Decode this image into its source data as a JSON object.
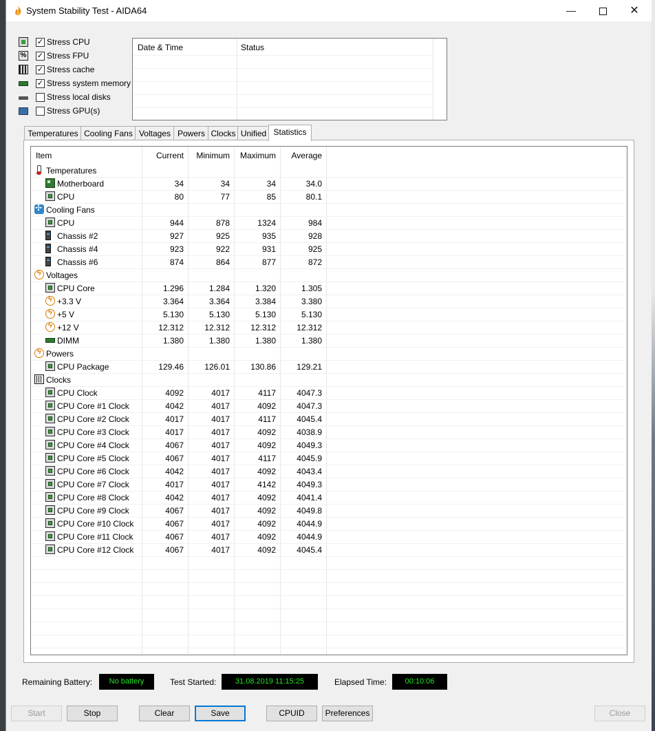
{
  "window": {
    "title": "System Stability Test - AIDA64"
  },
  "stress_options": [
    {
      "label": "Stress CPU",
      "checked": true,
      "icon": "cpu-icon"
    },
    {
      "label": "Stress FPU",
      "checked": true,
      "icon": "fpu-icon"
    },
    {
      "label": "Stress cache",
      "checked": true,
      "icon": "cache-icon"
    },
    {
      "label": "Stress system memory",
      "checked": true,
      "icon": "memory-icon"
    },
    {
      "label": "Stress local disks",
      "checked": false,
      "icon": "disk-icon"
    },
    {
      "label": "Stress GPU(s)",
      "checked": false,
      "icon": "gpu-icon"
    }
  ],
  "log": {
    "col_datetime": "Date & Time",
    "col_status": "Status"
  },
  "tabs": [
    "Temperatures",
    "Cooling Fans",
    "Voltages",
    "Powers",
    "Clocks",
    "Unified",
    "Statistics"
  ],
  "active_tab": "Statistics",
  "stats": {
    "headers": {
      "item": "Item",
      "current": "Current",
      "minimum": "Minimum",
      "maximum": "Maximum",
      "average": "Average"
    },
    "rows": [
      {
        "type": "group",
        "name": "Temperatures",
        "icon": "thermometer-icon"
      },
      {
        "type": "item",
        "name": "Motherboard",
        "icon": "motherboard-icon",
        "current": "34",
        "minimum": "34",
        "maximum": "34",
        "average": "34.0"
      },
      {
        "type": "item",
        "name": "CPU",
        "icon": "cpu-icon",
        "current": "80",
        "minimum": "77",
        "maximum": "85",
        "average": "80.1"
      },
      {
        "type": "group",
        "name": "Cooling Fans",
        "icon": "fan-icon"
      },
      {
        "type": "item",
        "name": "CPU",
        "icon": "cpu-icon",
        "current": "944",
        "minimum": "878",
        "maximum": "1324",
        "average": "984"
      },
      {
        "type": "item",
        "name": "Chassis #2",
        "icon": "chassis-icon",
        "current": "927",
        "minimum": "925",
        "maximum": "935",
        "average": "928"
      },
      {
        "type": "item",
        "name": "Chassis #4",
        "icon": "chassis-icon",
        "current": "923",
        "minimum": "922",
        "maximum": "931",
        "average": "925"
      },
      {
        "type": "item",
        "name": "Chassis #6",
        "icon": "chassis-icon",
        "current": "874",
        "minimum": "864",
        "maximum": "877",
        "average": "872"
      },
      {
        "type": "group",
        "name": "Voltages",
        "icon": "voltage-icon"
      },
      {
        "type": "item",
        "name": "CPU Core",
        "icon": "cpu-icon",
        "current": "1.296",
        "minimum": "1.284",
        "maximum": "1.320",
        "average": "1.305"
      },
      {
        "type": "item",
        "name": "+3.3 V",
        "icon": "voltage-icon",
        "current": "3.364",
        "minimum": "3.364",
        "maximum": "3.384",
        "average": "3.380"
      },
      {
        "type": "item",
        "name": "+5 V",
        "icon": "voltage-icon",
        "current": "5.130",
        "minimum": "5.130",
        "maximum": "5.130",
        "average": "5.130"
      },
      {
        "type": "item",
        "name": "+12 V",
        "icon": "voltage-icon",
        "current": "12.312",
        "minimum": "12.312",
        "maximum": "12.312",
        "average": "12.312"
      },
      {
        "type": "item",
        "name": "DIMM",
        "icon": "memory-icon",
        "current": "1.380",
        "minimum": "1.380",
        "maximum": "1.380",
        "average": "1.380"
      },
      {
        "type": "group",
        "name": "Powers",
        "icon": "voltage-icon"
      },
      {
        "type": "item",
        "name": "CPU Package",
        "icon": "cpu-icon",
        "current": "129.46",
        "minimum": "126.01",
        "maximum": "130.86",
        "average": "129.21"
      },
      {
        "type": "group",
        "name": "Clocks",
        "icon": "clock-icon"
      },
      {
        "type": "item",
        "name": "CPU Clock",
        "icon": "cpu-icon",
        "current": "4092",
        "minimum": "4017",
        "maximum": "4117",
        "average": "4047.3"
      },
      {
        "type": "item",
        "name": "CPU Core #1 Clock",
        "icon": "cpu-icon",
        "current": "4042",
        "minimum": "4017",
        "maximum": "4092",
        "average": "4047.3"
      },
      {
        "type": "item",
        "name": "CPU Core #2 Clock",
        "icon": "cpu-icon",
        "current": "4017",
        "minimum": "4017",
        "maximum": "4117",
        "average": "4045.4"
      },
      {
        "type": "item",
        "name": "CPU Core #3 Clock",
        "icon": "cpu-icon",
        "current": "4017",
        "minimum": "4017",
        "maximum": "4092",
        "average": "4038.9"
      },
      {
        "type": "item",
        "name": "CPU Core #4 Clock",
        "icon": "cpu-icon",
        "current": "4067",
        "minimum": "4017",
        "maximum": "4092",
        "average": "4049.3"
      },
      {
        "type": "item",
        "name": "CPU Core #5 Clock",
        "icon": "cpu-icon",
        "current": "4067",
        "minimum": "4017",
        "maximum": "4117",
        "average": "4045.9"
      },
      {
        "type": "item",
        "name": "CPU Core #6 Clock",
        "icon": "cpu-icon",
        "current": "4042",
        "minimum": "4017",
        "maximum": "4092",
        "average": "4043.4"
      },
      {
        "type": "item",
        "name": "CPU Core #7 Clock",
        "icon": "cpu-icon",
        "current": "4017",
        "minimum": "4017",
        "maximum": "4142",
        "average": "4049.3"
      },
      {
        "type": "item",
        "name": "CPU Core #8 Clock",
        "icon": "cpu-icon",
        "current": "4042",
        "minimum": "4017",
        "maximum": "4092",
        "average": "4041.4"
      },
      {
        "type": "item",
        "name": "CPU Core #9 Clock",
        "icon": "cpu-icon",
        "current": "4067",
        "minimum": "4017",
        "maximum": "4092",
        "average": "4049.8"
      },
      {
        "type": "item",
        "name": "CPU Core #10 Clock",
        "icon": "cpu-icon",
        "current": "4067",
        "minimum": "4017",
        "maximum": "4092",
        "average": "4044.9"
      },
      {
        "type": "item",
        "name": "CPU Core #11 Clock",
        "icon": "cpu-icon",
        "current": "4067",
        "minimum": "4017",
        "maximum": "4092",
        "average": "4044.9"
      },
      {
        "type": "item",
        "name": "CPU Core #12 Clock",
        "icon": "cpu-icon",
        "current": "4067",
        "minimum": "4017",
        "maximum": "4092",
        "average": "4045.4"
      }
    ]
  },
  "status": {
    "battery_label": "Remaining Battery:",
    "battery_value": "No battery",
    "started_label": "Test Started:",
    "started_value": "31.08.2019 11:15:25",
    "elapsed_label": "Elapsed Time:",
    "elapsed_value": "00:10:06"
  },
  "buttons": {
    "start": "Start",
    "stop": "Stop",
    "clear": "Clear",
    "save": "Save",
    "cpuid": "CPUID",
    "preferences": "Preferences",
    "close": "Close"
  },
  "colors": {
    "status_bg": "#000000",
    "status_text": "#22e822",
    "accent": "#0078d7"
  }
}
